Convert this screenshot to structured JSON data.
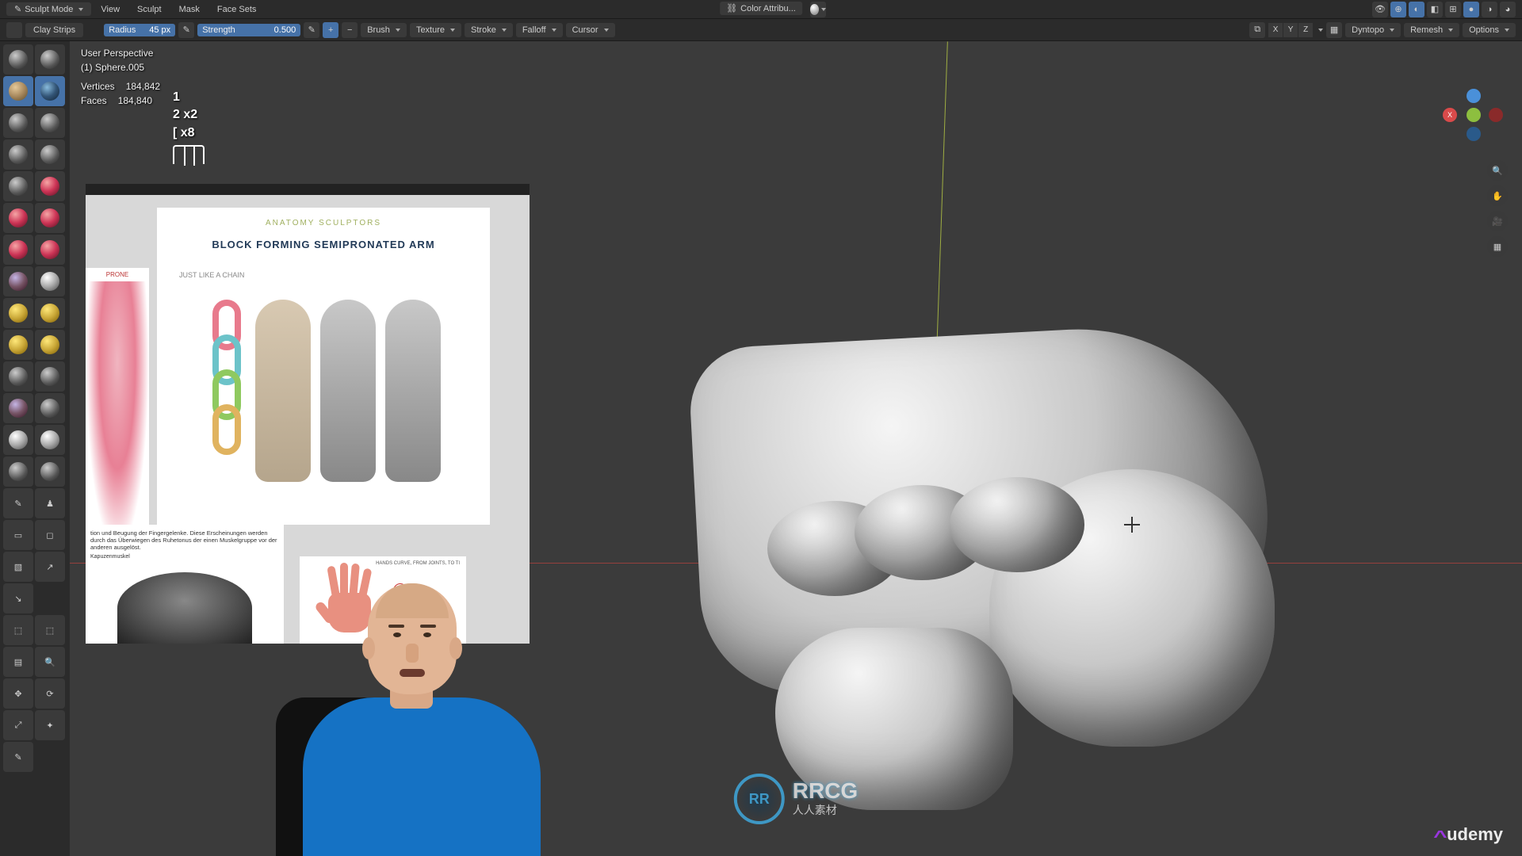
{
  "menubar": {
    "mode": "Sculpt Mode",
    "items": [
      "View",
      "Sculpt",
      "Mask",
      "Face Sets"
    ],
    "center_label": "Color Attribu..."
  },
  "toolbar": {
    "brush_name": "Clay Strips",
    "radius_label": "Radius",
    "radius_value": "45 px",
    "strength_label": "Strength",
    "strength_value": "0.500",
    "dropdowns": [
      "Brush",
      "Texture",
      "Stroke",
      "Falloff",
      "Cursor"
    ],
    "axes": [
      "X",
      "Y",
      "Z"
    ],
    "right": [
      "Dyntopo",
      "Remesh",
      "Options"
    ]
  },
  "stats": {
    "perspective": "User Perspective",
    "object": "(1) Sphere.005",
    "verts_label": "Vertices",
    "verts_value": "184,842",
    "faces_label": "Faces",
    "faces_value": "184,840"
  },
  "hotkeys": {
    "k1": "1",
    "k2": "2 x2",
    "k3": "[ x8"
  },
  "reference": {
    "logo": "ANATOMY SCULPTORS",
    "title": "BLOCK FORMING SEMIPRONATED ARM",
    "subtitle": "JUST LIKE A CHAIN",
    "side_label": "PRONE",
    "german_text": "tion und Beugung der Fingergelenke. Diese Erscheinungen werden durch das Überwiegen des Ruhetonus der einen Muskelgruppe vor der anderen ausgelöst.",
    "hand_label": "HANDS CURVE, FROM JOINTS, TO TI",
    "hand_sub": "Kapuzenmuskel"
  },
  "gizmo": {
    "x": "X",
    "y": "",
    "z": "",
    "nx": "",
    "nz": ""
  },
  "watermarks": {
    "rrcg_badge": "RR",
    "rrcg_main": "RRCG",
    "rrcg_sub": "人人素材",
    "udemy": "udemy"
  }
}
